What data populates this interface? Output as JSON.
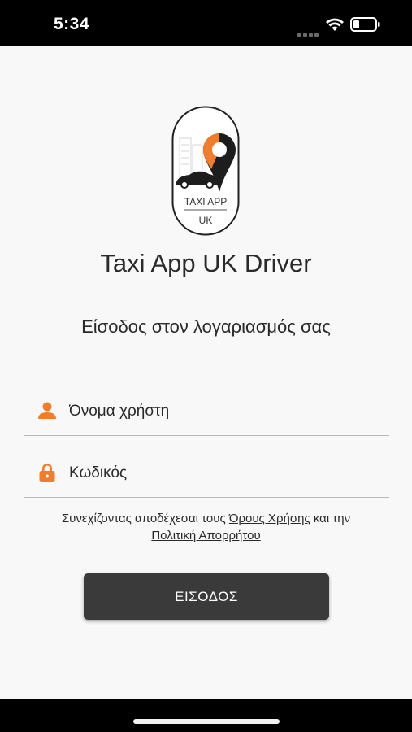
{
  "status_bar": {
    "time": "5:34"
  },
  "logo": {
    "line1": "TAXI APP",
    "line2": "UK"
  },
  "app_title": "Taxi App UK Driver",
  "subtitle": "Είσοδος στον λογαριασμός σας",
  "username_field": {
    "placeholder": "Όνομα χρήστη",
    "value": ""
  },
  "password_field": {
    "placeholder": "Κωδικός",
    "value": ""
  },
  "terms": {
    "prefix": "Συνεχίζοντας αποδέχεσαι τους ",
    "terms_link": "Όρους Χρήσης",
    "middle": " και την",
    "privacy_link": "Πολιτική Απορρήτου"
  },
  "login_button": {
    "label": "ΕΙΣΟΔΟΣ"
  },
  "colors": {
    "accent": "#ef7d2d",
    "button": "#3a3a3a",
    "background": "#f8f8f8"
  }
}
